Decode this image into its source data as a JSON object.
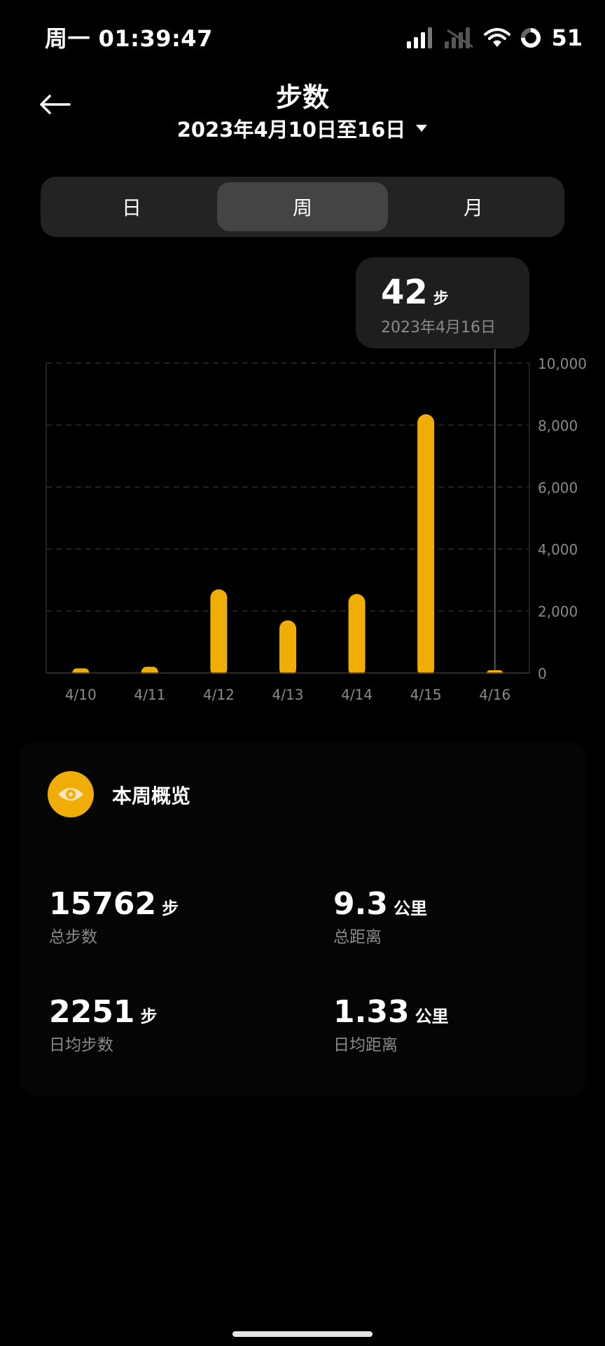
{
  "status_bar": {
    "time": "周一 01:39:47",
    "battery": "51",
    "icons": [
      "signal-icon",
      "signal-disabled-icon",
      "wifi-icon",
      "battery-icon"
    ]
  },
  "header": {
    "title": "步数",
    "date_range": "2023年4月10日至16日"
  },
  "tabs": [
    {
      "label": "日",
      "active": false
    },
    {
      "label": "周",
      "active": true
    },
    {
      "label": "月",
      "active": false
    }
  ],
  "tooltip": {
    "value": "42",
    "unit": "步",
    "date": "2023年4月16日"
  },
  "chart_data": {
    "type": "bar",
    "categories": [
      "4/10",
      "4/11",
      "4/12",
      "4/13",
      "4/14",
      "4/15",
      "4/16"
    ],
    "values": [
      150,
      200,
      2700,
      1700,
      2550,
      8350,
      42
    ],
    "yticks": [
      "0",
      "2,000",
      "4,000",
      "6,000",
      "8,000",
      "10,000"
    ],
    "ylim": [
      0,
      10000
    ],
    "selected_index": 6,
    "bar_color": "#f0ad06",
    "grid": true
  },
  "overview": {
    "title": "本周概览",
    "icon": "eye-icon",
    "accent_color": "#f0ad06",
    "total_steps": {
      "value": "15762",
      "unit": "步",
      "label": "总步数"
    },
    "total_distance": {
      "value": "9.3",
      "unit": "公里",
      "label": "总距离"
    },
    "avg_steps": {
      "value": "2251",
      "unit": "步",
      "label": "日均步数"
    },
    "avg_distance": {
      "value": "1.33",
      "unit": "公里",
      "label": "日均距离"
    }
  }
}
